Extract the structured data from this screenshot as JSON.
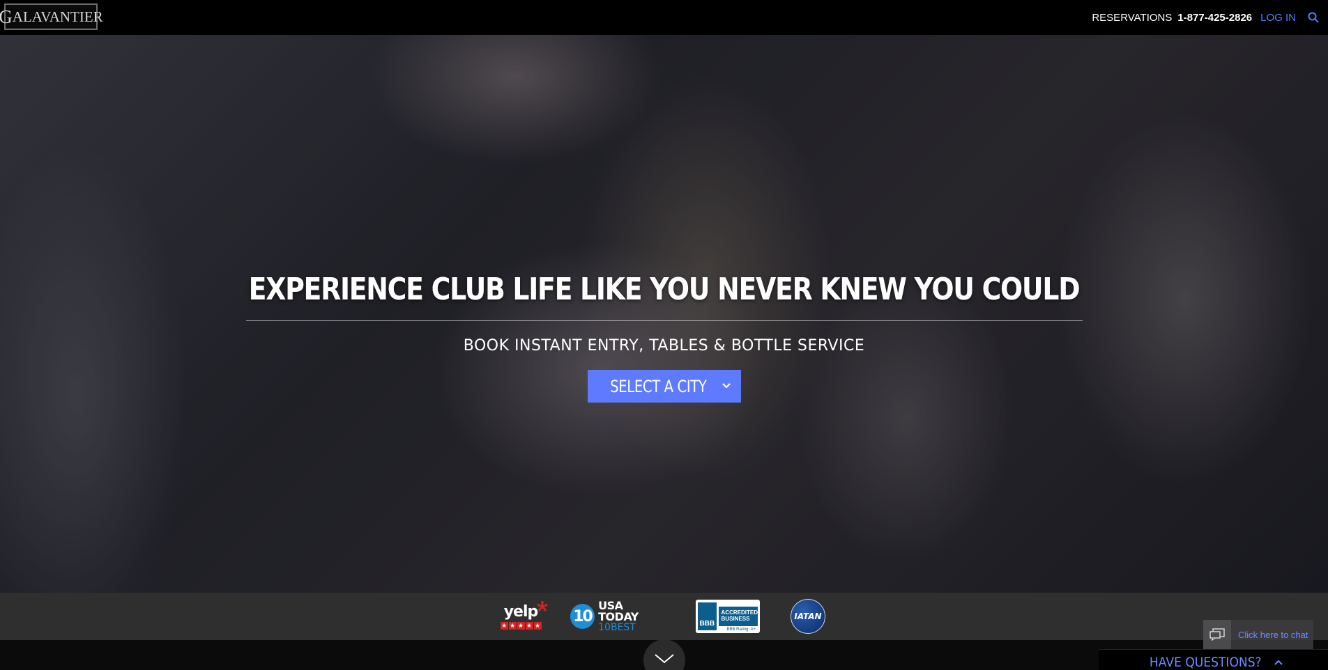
{
  "nav": {
    "logo_text_first": "G",
    "logo_text_rest": "ALAVANTIER",
    "reservations_label": "RESERVATIONS",
    "reservations_phone": "1-877-425-2826",
    "login_label": "LOG IN"
  },
  "hero": {
    "headline": "EXPERIENCE CLUB LIFE LIKE YOU NEVER KNEW YOU COULD",
    "subheadline": "BOOK INSTANT ENTRY, TABLES & BOTTLE SERVICE",
    "city_select_label": "SELECT A CITY"
  },
  "badges": {
    "yelp": "yelp",
    "usa_today_number": "10",
    "usa_today_title": "USA TODAY",
    "usa_today_sub": "10BEST",
    "bbb_short": "BBB",
    "bbb_line1": "ACCREDITED",
    "bbb_line2": "BUSINESS",
    "bbb_rating": "BBB Rating: A+",
    "iatan": "IATAN"
  },
  "chat": {
    "label": "Click here to chat"
  },
  "questions": {
    "label": "HAVE QUESTIONS?"
  },
  "colors": {
    "accent": "#5e7bff",
    "link": "#5a7bff",
    "nav_bg": "#000000"
  },
  "icons": {
    "search": "search-icon",
    "dropdown": "chevron-down-icon",
    "chat": "chat-bubble-icon",
    "scroll": "chevron-down-icon",
    "questions_toggle": "chevron-up-icon"
  }
}
